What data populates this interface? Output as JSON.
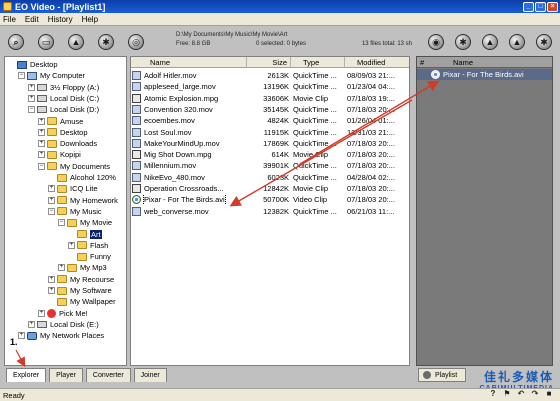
{
  "window": {
    "title": "EO Video - [Playlist1]"
  },
  "menu": [
    "File",
    "Edit",
    "History",
    "Help"
  ],
  "toolbar_left": [
    {
      "name": "zoom-icon",
      "glyph": "⌕"
    },
    {
      "name": "screen-icon",
      "glyph": "▭"
    },
    {
      "name": "eject-icon",
      "glyph": "▲"
    },
    {
      "name": "settings-icon",
      "glyph": "✱"
    },
    {
      "name": "target-icon",
      "glyph": "◎"
    }
  ],
  "toolbar_right": [
    {
      "name": "record-icon",
      "glyph": "◉"
    },
    {
      "name": "gear-icon",
      "glyph": "✱"
    },
    {
      "name": "eject-icon",
      "glyph": "▲"
    },
    {
      "name": "up-icon",
      "glyph": "▲"
    },
    {
      "name": "settings-icon",
      "glyph": "✱"
    },
    {
      "name": "search-icon",
      "glyph": "⌕"
    }
  ],
  "path_info": {
    "path": "D:\\My Documents\\My Music\\My Movie\\Art",
    "free": "Free: 8.8 GB",
    "selected": "0 selected: 0 bytes",
    "count": "13 files total: 13 sh"
  },
  "tree": [
    {
      "label": "Desktop",
      "icon": "desk",
      "level": 0,
      "exp": ""
    },
    {
      "label": "My Computer",
      "icon": "computer",
      "level": 1,
      "exp": "−"
    },
    {
      "label": "3½ Floppy (A:)",
      "icon": "drive",
      "level": 2,
      "exp": "+"
    },
    {
      "label": "Local Disk (C:)",
      "icon": "drive",
      "level": 2,
      "exp": "+"
    },
    {
      "label": "Local Disk (D:)",
      "icon": "drive",
      "level": 2,
      "exp": "−"
    },
    {
      "label": "Amuse",
      "icon": "folder",
      "level": 3,
      "exp": "+"
    },
    {
      "label": "Desktop",
      "icon": "folder",
      "level": 3,
      "exp": "+"
    },
    {
      "label": "Downloads",
      "icon": "folder",
      "level": 3,
      "exp": "+"
    },
    {
      "label": "Kopipi",
      "icon": "folder",
      "level": 3,
      "exp": "+"
    },
    {
      "label": "My Documents",
      "icon": "folder",
      "level": 3,
      "exp": "−"
    },
    {
      "label": "Alcohol 120%",
      "icon": "folder",
      "level": 4,
      "exp": ""
    },
    {
      "label": "ICQ Lite",
      "icon": "folder",
      "level": 4,
      "exp": "+"
    },
    {
      "label": "My Homework",
      "icon": "folder",
      "level": 4,
      "exp": "+"
    },
    {
      "label": "My Music",
      "icon": "folder",
      "level": 4,
      "exp": "−"
    },
    {
      "label": "My Movie",
      "icon": "folder",
      "level": 5,
      "exp": "−"
    },
    {
      "label": "Art",
      "icon": "folder",
      "level": 6,
      "exp": "",
      "selected": true
    },
    {
      "label": "Flash",
      "icon": "folder",
      "level": 6,
      "exp": "+"
    },
    {
      "label": "Funny",
      "icon": "folder",
      "level": 6,
      "exp": ""
    },
    {
      "label": "My Mp3",
      "icon": "folder",
      "level": 5,
      "exp": "+"
    },
    {
      "label": "My Recourse",
      "icon": "folder",
      "level": 4,
      "exp": "+"
    },
    {
      "label": "My Software",
      "icon": "folder",
      "level": 4,
      "exp": "+"
    },
    {
      "label": "My Wallpaper",
      "icon": "folder",
      "level": 4,
      "exp": ""
    },
    {
      "label": "Pick Me!",
      "icon": "star",
      "level": 3,
      "exp": "+"
    },
    {
      "label": "Local Disk (E:)",
      "icon": "drive",
      "level": 2,
      "exp": "+"
    },
    {
      "label": "My Network Places",
      "icon": "net",
      "level": 1,
      "exp": "+"
    }
  ],
  "file_columns": {
    "name": "Name",
    "size": "Size",
    "type": "Type",
    "modified": "Modified"
  },
  "files": [
    {
      "name": "Adolf Hitler.mov",
      "size": "2613K",
      "type": "QuickTime ...",
      "modified": "08/09/03 21:...",
      "icon": "mov"
    },
    {
      "name": "appleseed_large.mov",
      "size": "13196K",
      "type": "QuickTime ...",
      "modified": "01/23/04 04:...",
      "icon": "mov"
    },
    {
      "name": "Atomic Explosion.mpg",
      "size": "33606K",
      "type": "Movie Clip",
      "modified": "07/18/03 19:...",
      "icon": "mpg"
    },
    {
      "name": "Convention 320.mov",
      "size": "35145K",
      "type": "QuickTime ...",
      "modified": "07/18/03 20:...",
      "icon": "mov"
    },
    {
      "name": "ecoembes.mov",
      "size": "4824K",
      "type": "QuickTime ...",
      "modified": "01/26/04 01:...",
      "icon": "mov"
    },
    {
      "name": "Lost Soul.mov",
      "size": "11915K",
      "type": "QuickTime ...",
      "modified": "12/31/03 21:...",
      "icon": "mov"
    },
    {
      "name": "MakeYourMindUp.mov",
      "size": "17869K",
      "type": "QuickTime ...",
      "modified": "07/18/03 20:...",
      "icon": "mov"
    },
    {
      "name": "Mig Shot Down.mpg",
      "size": "614K",
      "type": "Movie Clip",
      "modified": "07/18/03 20:...",
      "icon": "mpg"
    },
    {
      "name": "Millennium.mov",
      "size": "39901K",
      "type": "QuickTime ...",
      "modified": "07/18/03 20:...",
      "icon": "mov"
    },
    {
      "name": "NikeEvo_480.mov",
      "size": "6023K",
      "type": "QuickTime ...",
      "modified": "04/28/04 02:...",
      "icon": "mov"
    },
    {
      "name": "Operation Crossroads...",
      "size": "12842K",
      "type": "Movie Clip",
      "modified": "07/18/03 20:...",
      "icon": "mpg"
    },
    {
      "name": "Pixar - For The Birds.avi",
      "size": "50700K",
      "type": "Video Clip",
      "modified": "07/18/03 20:...",
      "icon": "avi",
      "selected": true
    },
    {
      "name": "web_converse.mov",
      "size": "12382K",
      "type": "QuickTime ...",
      "modified": "06/21/03 11:...",
      "icon": "mov"
    }
  ],
  "playlist": {
    "col_hash": "#",
    "col_name": "Name",
    "items": [
      {
        "name": "Pixar - For The Birds.avi"
      }
    ]
  },
  "tabs": [
    "Explorer",
    "Player",
    "Converter",
    "Joiner"
  ],
  "playlist_tab": "Playlist",
  "watermark": {
    "cn": "佳礼多媒体",
    "en": "CARIMULTIMEDIA"
  },
  "annotation": "1.",
  "status": {
    "text": "Ready"
  }
}
